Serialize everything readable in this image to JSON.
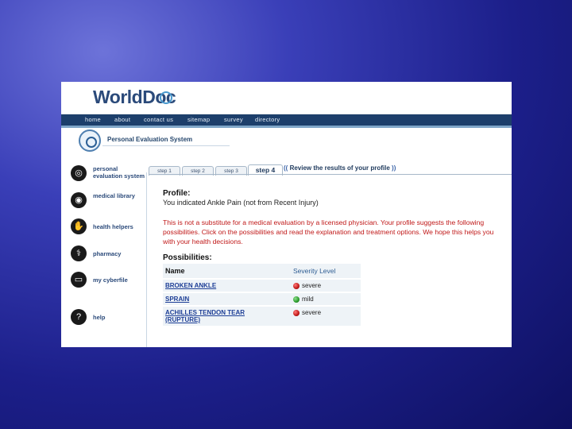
{
  "logo": {
    "text": "WorldDoc"
  },
  "nav": {
    "items": [
      "home",
      "about",
      "contact us",
      "sitemap",
      "survey",
      "directory"
    ]
  },
  "pes": {
    "title": "Personal Evaluation System"
  },
  "sidebar": {
    "items": [
      {
        "label": "personal evaluation system",
        "icon": "evaluation-icon"
      },
      {
        "label": "medical library",
        "icon": "library-icon"
      },
      {
        "label": "health helpers",
        "icon": "hand-icon"
      },
      {
        "label": "pharmacy",
        "icon": "pharmacy-icon"
      },
      {
        "label": "my cyberfile",
        "icon": "cyberfile-icon"
      },
      {
        "label": "help",
        "icon": "help-icon"
      }
    ]
  },
  "tabs": {
    "items": [
      "step 1",
      "step 2",
      "step 3",
      "step 4"
    ],
    "active_index": 3,
    "review_label": "Review the results of your profile"
  },
  "profile": {
    "heading": "Profile:",
    "text": "You indicated Ankle Pain (not from Recent Injury)"
  },
  "disclaimer": "This is not a substitute for a medical evaluation by a licensed physician. Your profile suggests the following possibilities. Click on the possibilities and read the explanation and treatment options. We hope this helps you with your health decisions.",
  "possibilities": {
    "heading": "Possibilities:",
    "columns": [
      "Name",
      "Severity Level"
    ],
    "rows": [
      {
        "name": "BROKEN ANKLE",
        "name_extra": "",
        "severity": "severe",
        "color": "#c01818"
      },
      {
        "name": "SPRAIN",
        "name_extra": "",
        "severity": "mild",
        "color": "#2a9a2a"
      },
      {
        "name": "ACHILLES TENDON TEAR",
        "name_extra": "(RUPTURE)",
        "severity": "severe",
        "color": "#c01818"
      }
    ]
  }
}
